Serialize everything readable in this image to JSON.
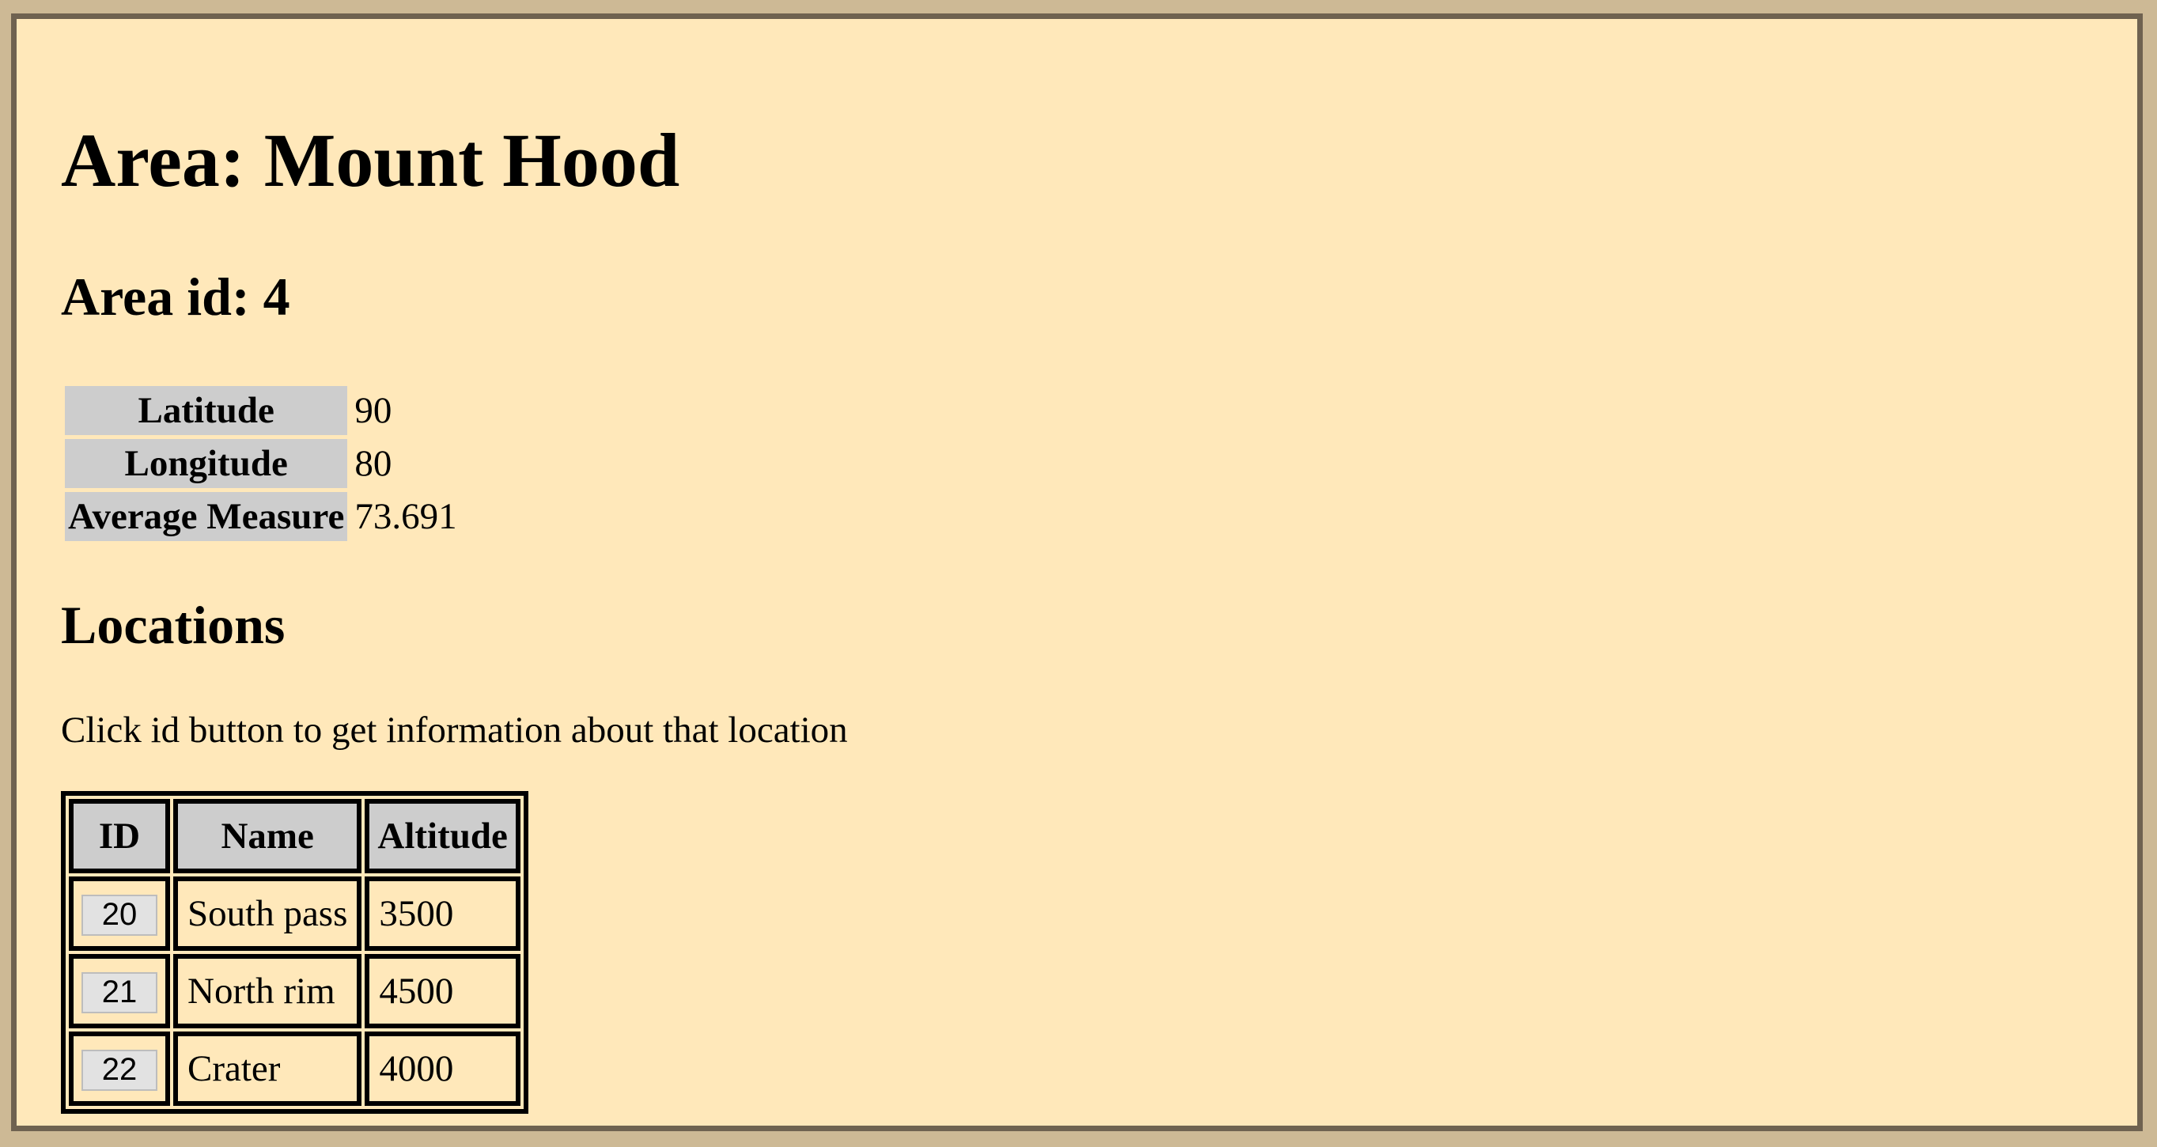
{
  "page": {
    "title": "Area: Mount Hood",
    "area_id_label": "Area id: 4"
  },
  "area_info": [
    {
      "label": "Latitude",
      "value": "90"
    },
    {
      "label": "Longitude",
      "value": "80"
    },
    {
      "label": "Average Measure",
      "value": "73.691"
    }
  ],
  "locations": {
    "title": "Locations",
    "hint": "Click id button to get information about that location",
    "headers": {
      "id": "ID",
      "name": "Name",
      "altitude": "Altitude"
    },
    "rows": [
      {
        "id": "20",
        "name": "South pass",
        "altitude": "3500"
      },
      {
        "id": "21",
        "name": "North rim",
        "altitude": "4500"
      },
      {
        "id": "22",
        "name": "Crater",
        "altitude": "4000"
      }
    ]
  },
  "colors": {
    "page_background": "#ffe8ba",
    "outer_background": "#cdb995",
    "frame_border": "#6f6250",
    "header_cell": "#cdcdcd",
    "button": "#e2e2e2"
  }
}
